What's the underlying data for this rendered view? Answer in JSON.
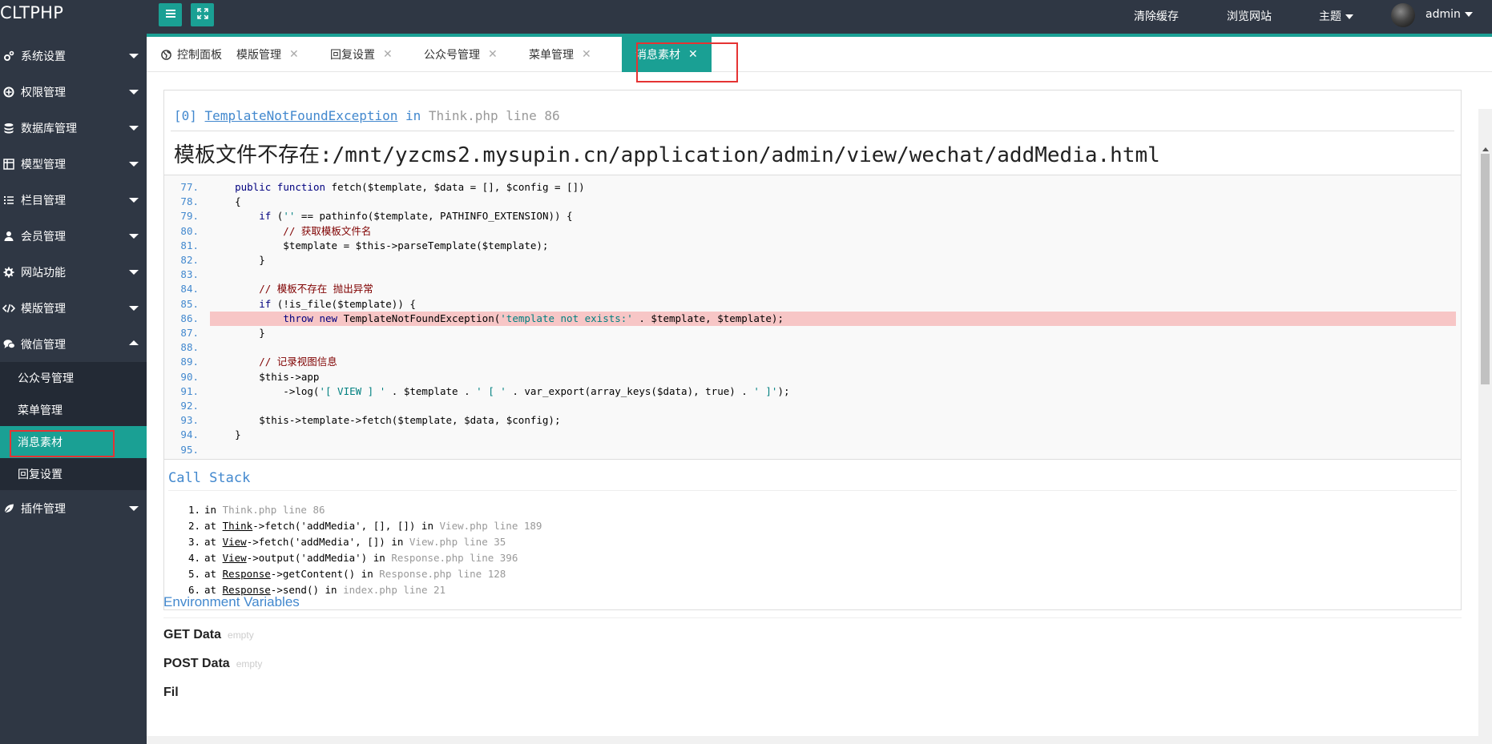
{
  "app": {
    "logo": "CLTPHP"
  },
  "topbar": {
    "clear_cache": "清除缓存",
    "browse_site": "浏览网站",
    "theme": "主题",
    "user": "admin"
  },
  "sidebar": {
    "items": [
      {
        "label": "系统设置",
        "icon": "gears-icon"
      },
      {
        "label": "权限管理",
        "icon": "shield-icon"
      },
      {
        "label": "数据库管理",
        "icon": "database-icon"
      },
      {
        "label": "模型管理",
        "icon": "grid-icon"
      },
      {
        "label": "栏目管理",
        "icon": "list-icon"
      },
      {
        "label": "会员管理",
        "icon": "user-icon"
      },
      {
        "label": "网站功能",
        "icon": "gear-icon"
      },
      {
        "label": "模版管理",
        "icon": "code-icon"
      },
      {
        "label": "微信管理",
        "icon": "chat-icon"
      },
      {
        "label": "插件管理",
        "icon": "leaf-icon"
      }
    ],
    "wechat_sub": [
      "公众号管理",
      "菜单管理",
      "消息素材",
      "回复设置"
    ]
  },
  "tabs": [
    {
      "label": "控制面板",
      "closable": false,
      "icon": "globe-icon"
    },
    {
      "label": "模版管理",
      "closable": true
    },
    {
      "label": "回复设置",
      "closable": true
    },
    {
      "label": "公众号管理",
      "closable": true
    },
    {
      "label": "菜单管理",
      "closable": true
    },
    {
      "label": "消息素材",
      "closable": true,
      "active": true
    }
  ],
  "error": {
    "index": "[0]",
    "exception": "TemplateNotFoundException",
    "in": "in",
    "file_line": "Think.php line 86",
    "message": "模板文件不存在:/mnt/yzcms2.mysupin.cn/application/admin/view/wechat/addMedia.html",
    "highlight_line": 86,
    "code_lines": [
      {
        "n": "77.",
        "src": "    public function fetch($template, $data = [], $config = [])"
      },
      {
        "n": "78.",
        "src": "    {"
      },
      {
        "n": "79.",
        "src": "        if ('' == pathinfo($template, PATHINFO_EXTENSION)) {"
      },
      {
        "n": "80.",
        "src": "            // 获取模板文件名"
      },
      {
        "n": "81.",
        "src": "            $template = $this->parseTemplate($template);"
      },
      {
        "n": "82.",
        "src": "        }"
      },
      {
        "n": "83.",
        "src": ""
      },
      {
        "n": "84.",
        "src": "        // 模板不存在 抛出异常"
      },
      {
        "n": "85.",
        "src": "        if (!is_file($template)) {"
      },
      {
        "n": "86.",
        "src": "            throw new TemplateNotFoundException('template not exists:' . $template, $template);"
      },
      {
        "n": "87.",
        "src": "        }"
      },
      {
        "n": "88.",
        "src": ""
      },
      {
        "n": "89.",
        "src": "        // 记录视图信息"
      },
      {
        "n": "90.",
        "src": "        $this->app"
      },
      {
        "n": "91.",
        "src": "            ->log('[ VIEW ] ' . $template . ' [ ' . var_export(array_keys($data), true) . ' ]');"
      },
      {
        "n": "92.",
        "src": ""
      },
      {
        "n": "93.",
        "src": "        $this->template->fetch($template, $data, $config);"
      },
      {
        "n": "94.",
        "src": "    }"
      },
      {
        "n": "95.",
        "src": ""
      }
    ],
    "call_stack_title": "Call Stack",
    "call_stack": [
      "in Think.php line 86",
      "at Think->fetch('addMedia', [], []) in View.php line 189",
      "at View->fetch('addMedia', []) in View.php line 35",
      "at View->output('addMedia') in Response.php line 396",
      "at Response->getContent() in Response.php line 128",
      "at Response->send() in index.php line 21"
    ],
    "env_title": "Environment Variables",
    "get_data": "GET Data",
    "post_data": "POST Data",
    "empty": "empty",
    "files_partial": "Fil"
  },
  "colors": {
    "accent": "#1aa094",
    "sidebar_bg": "#2f3744",
    "sub_bg": "#232a35",
    "highlight": "#f7c6c6",
    "link": "#4288ce",
    "annotation": "#e53333"
  }
}
